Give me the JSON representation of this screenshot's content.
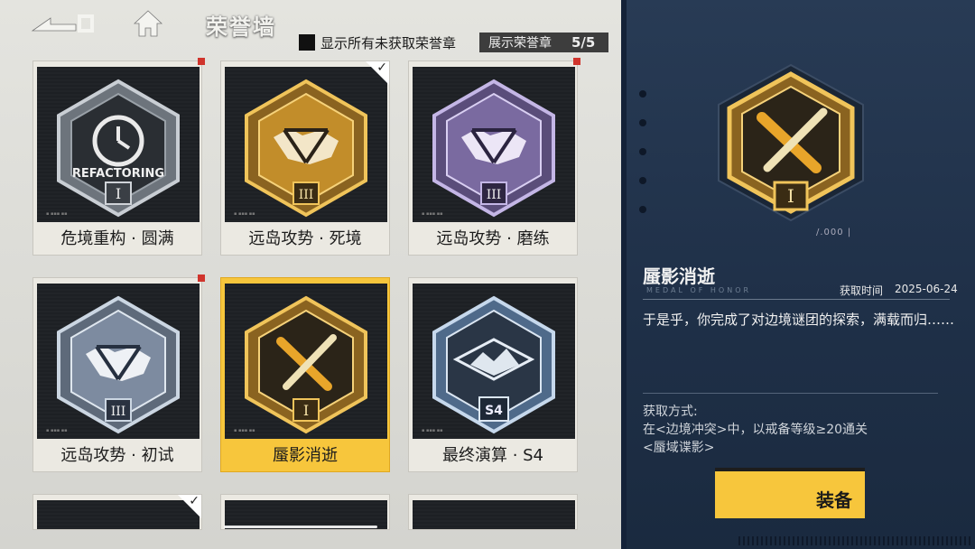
{
  "header": {
    "title": "荣誉墙",
    "toggle_label": "显示所有未获取荣誉章",
    "show_label": "展示荣誉章",
    "show_count": "5/5"
  },
  "cards": [
    {
      "label": "危境重构 · 圆满",
      "medal_text": "REFACTORING",
      "tier": "I",
      "tint": "silver"
    },
    {
      "label": "远岛攻势 · 死境",
      "tier": "III",
      "tint": "gold"
    },
    {
      "label": "远岛攻势 · 磨练",
      "tier": "III",
      "tint": "purple"
    },
    {
      "label": "远岛攻势 · 初试",
      "tier": "III",
      "tint": "silver"
    },
    {
      "label": "蜃影消逝",
      "tier": "I",
      "tint": "gold"
    },
    {
      "label": "最终演算 · S4",
      "tier": "S4",
      "tint": "blue"
    }
  ],
  "detail": {
    "name": "蜃影消逝",
    "subtitle": "MEDAL OF HONOR",
    "code": "/.000 |",
    "acq_time_label": "获取时间",
    "acq_time_value": "2025-06-24",
    "description": "于是乎，你完成了对边境谜团的探索，满载而归……",
    "method_label": "获取方式:",
    "method_line1": "在<边境冲突>中，以戒备等级≥20通关",
    "method_line2": "<蜃域谍影>",
    "equip_label": "装备"
  },
  "colors": {
    "accent": "#f7c63c",
    "panel": "#1f3048",
    "gold": "#d9a233"
  },
  "icons": [
    "back-icon",
    "home-icon",
    "check-icon"
  ]
}
